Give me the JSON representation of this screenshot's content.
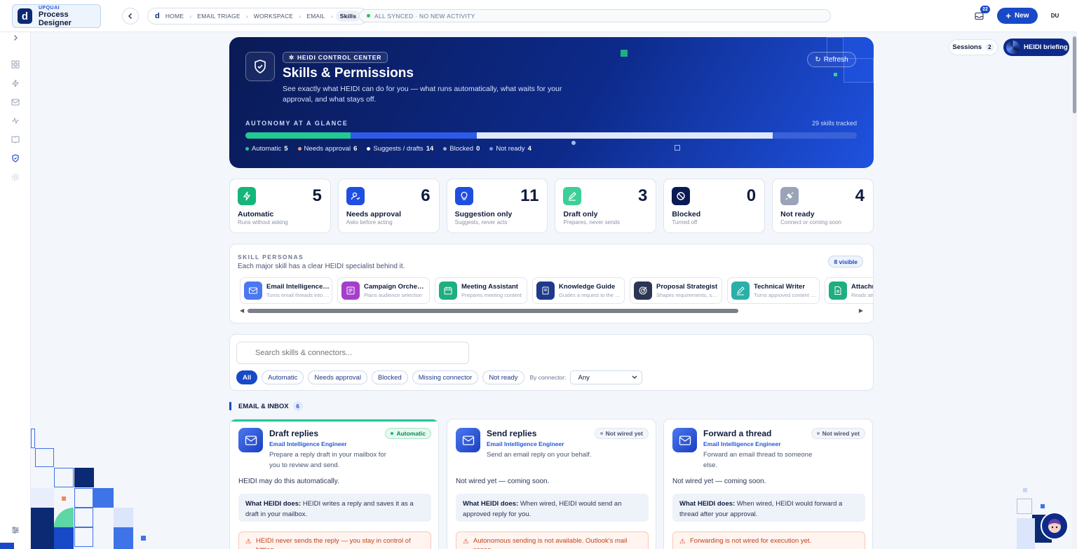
{
  "brand": {
    "sub": "UPQUAI",
    "title": "Process Designer",
    "logo": "d"
  },
  "breadcrumb": {
    "items": [
      "HOME",
      "EMAIL TRIAGE",
      "WORKSPACE",
      "EMAIL"
    ],
    "current": "Skills"
  },
  "status": {
    "text": "ALL SYNCED · NO NEW ACTIVITY",
    "color": "#22c55e"
  },
  "header": {
    "inbox_count": "22",
    "new_label": "New",
    "user_initials": "DU"
  },
  "side_panel": {
    "sessions_label": "Sessions",
    "sessions_count": "2",
    "briefing_label": "HEIDI briefing"
  },
  "hero": {
    "tag": "HEIDI CONTROL CENTER",
    "title": "Skills & Permissions",
    "description": "See exactly what HEIDI can do for you — what runs automatically, what waits for your approval, and what stays off.",
    "refresh_label": "Refresh",
    "autonomy_label": "AUTONOMY AT A GLANCE",
    "tracked": "29 skills tracked",
    "legend": [
      {
        "label": "Automatic",
        "count": "5",
        "color": "#22c993"
      },
      {
        "label": "Needs approval",
        "count": "6",
        "color": "#f59a6b"
      },
      {
        "label": "Suggests / drafts",
        "count": "14",
        "color": "#ffffff"
      },
      {
        "label": "Blocked",
        "count": "0",
        "color": "#9fb0d8"
      },
      {
        "label": "Not ready",
        "count": "4",
        "color": "#7d93d6"
      }
    ],
    "bar_fractions": [
      0.172,
      0.207,
      0.483,
      0.0,
      0.138
    ]
  },
  "stats": [
    {
      "count": "5",
      "label": "Automatic",
      "sub": "Runs without asking",
      "color": "#16b57c",
      "icon": "bolt-icon"
    },
    {
      "count": "6",
      "label": "Needs approval",
      "sub": "Asks before acting",
      "color": "#1f4fe0",
      "icon": "user-check-icon"
    },
    {
      "count": "11",
      "label": "Suggestion only",
      "sub": "Suggests, never acts",
      "color": "#1f4fe0",
      "icon": "lightbulb-icon"
    },
    {
      "count": "3",
      "label": "Draft only",
      "sub": "Prepares, never sends",
      "color": "#3ccf97",
      "icon": "pencil-icon"
    },
    {
      "count": "0",
      "label": "Blocked",
      "sub": "Turned off",
      "color": "#0b1a55",
      "icon": "block-icon"
    },
    {
      "count": "4",
      "label": "Not ready",
      "sub": "Connect or coming soon",
      "color": "#9aa3b8",
      "icon": "plug-icon"
    }
  ],
  "personas": {
    "heading": "SKILL PERSONAS",
    "subtitle": "Each major skill has a clear HEIDI specialist behind it.",
    "visible": "8 visible",
    "items": [
      {
        "name": "Email Intelligence Engineer",
        "desc": "Turns email threads into tasks",
        "color": "#4b78f0",
        "icon": "mail-icon"
      },
      {
        "name": "Campaign Orchestrator",
        "desc": "Plans audience selection",
        "color": "#a53fc9",
        "icon": "campaign-icon"
      },
      {
        "name": "Meeting Assistant",
        "desc": "Prepares meeting content",
        "color": "#1fae80",
        "icon": "calendar-icon"
      },
      {
        "name": "Knowledge Guide",
        "desc": "Guides a request to the right source",
        "color": "#1e3a8a",
        "icon": "book-icon"
      },
      {
        "name": "Proposal Strategist",
        "desc": "Shapes requirements, scope",
        "color": "#2b3554",
        "icon": "target-icon"
      },
      {
        "name": "Technical Writer",
        "desc": "Turns approved content into docs",
        "color": "#2bb0a8",
        "icon": "pen-icon"
      },
      {
        "name": "Attachment Reader",
        "desc": "Reads attachments",
        "color": "#1fae80",
        "icon": "document-icon"
      }
    ]
  },
  "filters": {
    "search_placeholder": "Search skills & connectors...",
    "chips": [
      "All",
      "Automatic",
      "Needs approval",
      "Blocked",
      "Missing connector",
      "Not ready"
    ],
    "connector_label": "By connector:",
    "connector_value": "Any"
  },
  "section": {
    "title": "EMAIL & INBOX",
    "count": "6"
  },
  "skills": [
    {
      "title": "Draft replies",
      "persona": "Email Intelligence Engineer",
      "desc": "Prepare a reply draft in your mailbox for you to review and send.",
      "status": "Automatic",
      "status_color": "#16b57c",
      "may": "HEIDI may do this automatically.",
      "what_label": "What HEIDI does:",
      "what": "HEIDI writes a reply and saves it as a draft in your mailbox.",
      "warn": "HEIDI never sends the reply — you stay in control of hitting"
    },
    {
      "title": "Send replies",
      "persona": "Email Intelligence Engineer",
      "desc": "Send an email reply on your behalf.",
      "status": "Not wired yet",
      "status_color": "#9aa3b8",
      "may": "Not wired yet — coming soon.",
      "what_label": "What HEIDI does:",
      "what": "When wired, HEIDI would send an approved reply for you.",
      "warn": "Autonomous sending is not available. Outlook's mail scope"
    },
    {
      "title": "Forward a thread",
      "persona": "Email Intelligence Engineer",
      "desc": "Forward an email thread to someone else.",
      "status": "Not wired yet",
      "status_color": "#9aa3b8",
      "may": "Not wired yet — coming soon.",
      "what_label": "What HEIDI does:",
      "what": "When wired, HEIDI would forward a thread after your approval.",
      "warn": "Forwarding is not wired for execution yet."
    }
  ]
}
